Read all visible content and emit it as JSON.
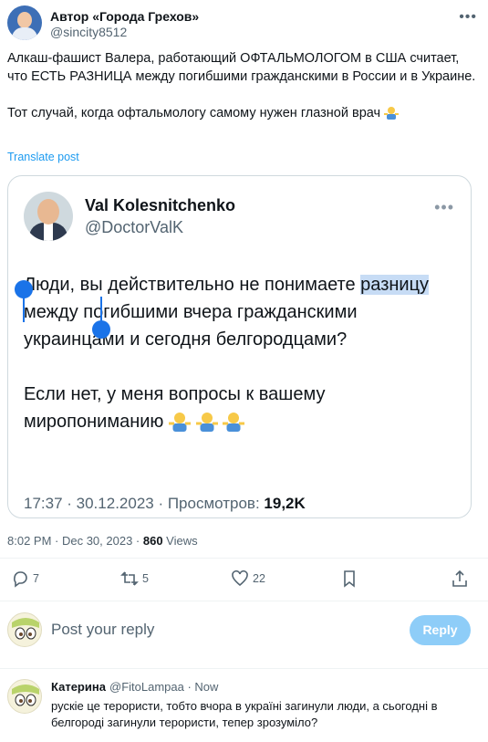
{
  "post": {
    "display_name": "Автор «Города Грехов»",
    "handle": "@sincity8512",
    "text_line1": "Алкаш-фашист Валера, работающий ОФТАЛЬМОЛОГОМ в США считает, что ЕСТЬ РАЗНИЦА между погибшими гражданскими в России и в Украине.",
    "text_line2": "Тот случай, когда офтальмологу самому нужен глазной врач",
    "translate_label": "Translate post",
    "timestamp": "8:02 PM · Dec 30, 2023 · ",
    "views_count": "860",
    "views_label": " Views"
  },
  "quote": {
    "display_name": "Val Kolesnitchenko",
    "handle": "@DoctorValK",
    "para1_start": "Люди, вы действительно не понимаете ",
    "para1_selected": "разницу",
    "para1_end": " между погибшими вчера гражданскими украинцами и сегодня белгородцами?",
    "para2": "Если нет, у меня вопросы к вашему миропониманию",
    "meta": "17:37 · 30.12.2023 · Просмотров: ",
    "views": "19,2K"
  },
  "actions": {
    "replies": "7",
    "reposts": "5",
    "likes": "22"
  },
  "reply_box": {
    "placeholder": "Post your reply",
    "button_label": "Reply"
  },
  "comment": {
    "name": "Катерина",
    "handle_time": "@FitoLampaa · Now",
    "text": "рускіе це терористи, тобто вчора в україні загинули люди, а сьогодні в белгороді загинули терористи, тепер зрозуміло?"
  },
  "colors": {
    "accent": "#1d9bf0",
    "reply_button": "#8ecdf8",
    "selection": "#1a73e8"
  }
}
